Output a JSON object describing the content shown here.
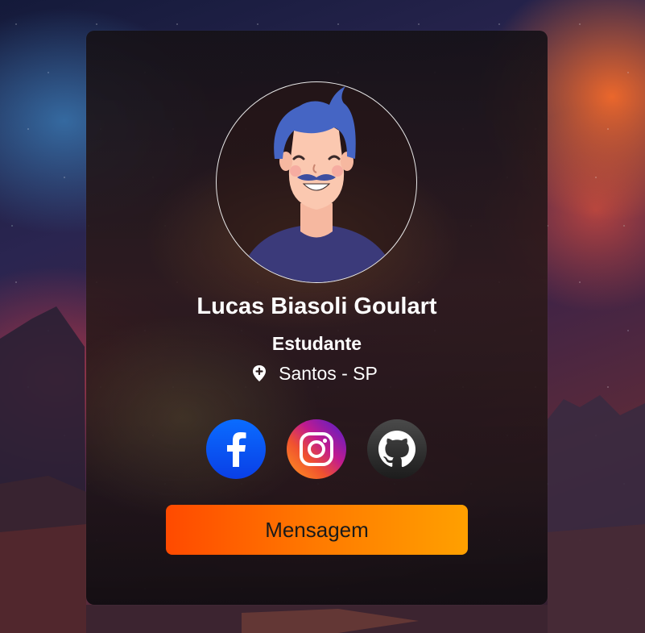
{
  "profile": {
    "name": "Lucas Biasoli Goulart",
    "role": "Estudante",
    "location": "Santos - SP",
    "avatar_icon": "avatar-illustration"
  },
  "location_icon": "map-pin-icon",
  "social": [
    {
      "name": "Facebook",
      "icon": "facebook-icon",
      "color": "#0a6cff"
    },
    {
      "name": "Instagram",
      "icon": "instagram-icon",
      "color": "#c11b8f"
    },
    {
      "name": "GitHub",
      "icon": "github-icon",
      "color": "#2b2b2b"
    }
  ],
  "button": {
    "label": "Mensagem",
    "gradient": [
      "#ff4a00",
      "#ffa000"
    ]
  }
}
